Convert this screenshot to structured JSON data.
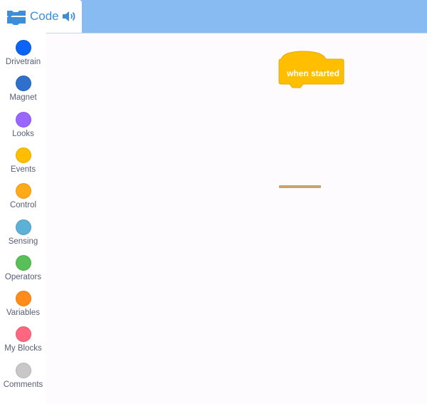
{
  "header": {
    "code_tab_label": "Code",
    "icons": [
      "code-blocks-icon",
      "speaker-icon"
    ]
  },
  "sidebar": {
    "categories": [
      {
        "label": "Drivetrain",
        "color": "#0b64f5",
        "border": "#0a57d5"
      },
      {
        "label": "Magnet",
        "color": "#2e70cc",
        "border": "#2862b5"
      },
      {
        "label": "Looks",
        "color": "#9966ff",
        "border": "#855ce6"
      },
      {
        "label": "Events",
        "color": "#ffbf00",
        "border": "#e6ac00"
      },
      {
        "label": "Control",
        "color": "#ffab19",
        "border": "#e69a16"
      },
      {
        "label": "Sensing",
        "color": "#5cb1d6",
        "border": "#4f9ec0"
      },
      {
        "label": "Operators",
        "color": "#59c059",
        "border": "#4ea94e"
      },
      {
        "label": "Variables",
        "color": "#ff8c1a",
        "border": "#e67d17"
      },
      {
        "label": "My Blocks",
        "color": "#ff6680",
        "border": "#e65c73"
      },
      {
        "label": "Comments",
        "color": "#c8c8c8",
        "border": "#b4b4b4"
      }
    ]
  },
  "workspace": {
    "hat_block": {
      "label": "when started",
      "color": "#ffbf00",
      "border": "#e6a800"
    }
  }
}
